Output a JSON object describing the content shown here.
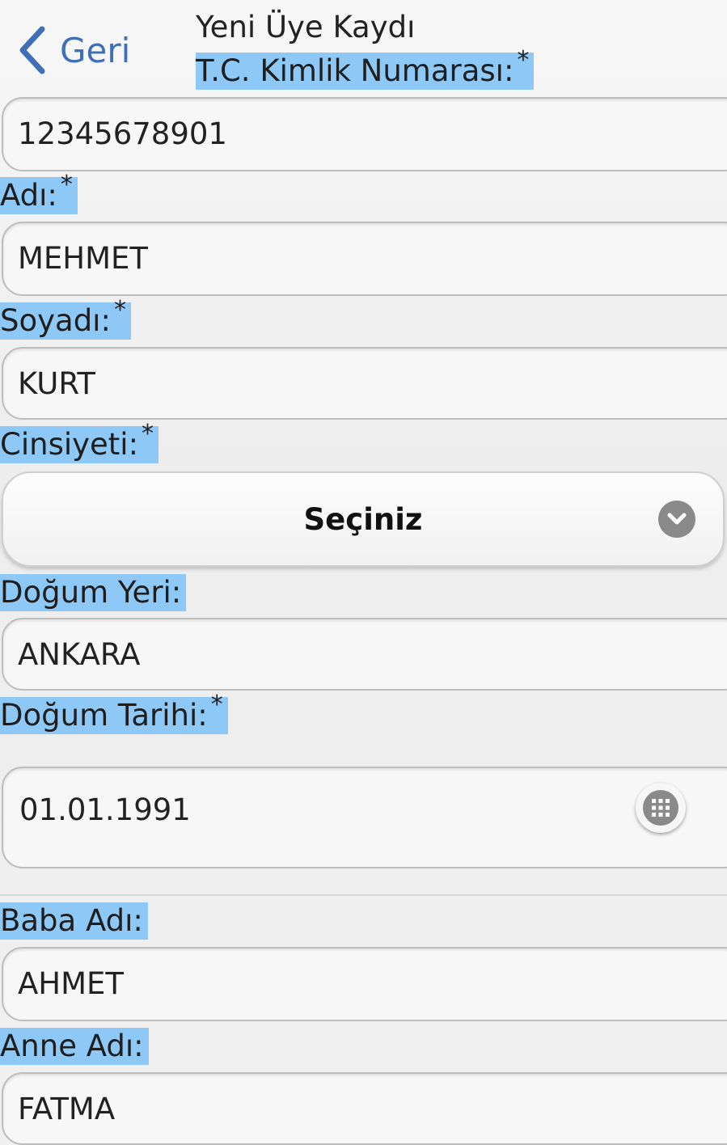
{
  "header": {
    "back_label": "Geri",
    "title": "Yeni Üye Kaydı"
  },
  "accent_color": "#3f6fb6",
  "label_highlight_color": "#8ec8f6",
  "form": {
    "tc": {
      "label": "T.C. Kimlik Numarası:",
      "required": "*",
      "value": "12345678901"
    },
    "ad": {
      "label": "Adı:",
      "required": "*",
      "value": "MEHMET"
    },
    "soyad": {
      "label": "Soyadı:",
      "required": "*",
      "value": "KURT"
    },
    "cinsiyet": {
      "label": "Cinsiyeti:",
      "required": "*",
      "selected": "Seçiniz",
      "icon": "chevron-down-circle-icon"
    },
    "dogum_yeri": {
      "label": "Doğum Yeri:",
      "value": "ANKARA"
    },
    "dogum_tarihi": {
      "label": "Doğum Tarihi:",
      "required": "*",
      "value": "01.01.1991",
      "icon": "calendar-grid-icon"
    },
    "baba_adi": {
      "label": "Baba Adı:",
      "value": "AHMET"
    },
    "anne_adi": {
      "label": "Anne Adı:",
      "value": "FATMA"
    }
  }
}
